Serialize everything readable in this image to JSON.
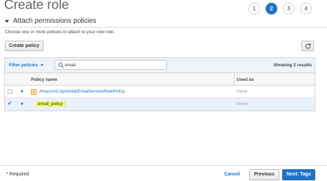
{
  "page": {
    "title": "Create role"
  },
  "steps": [
    {
      "label": "1"
    },
    {
      "label": "2"
    },
    {
      "label": "3"
    },
    {
      "label": "4"
    }
  ],
  "active_step": "2",
  "section": {
    "title": "Attach permissions policies",
    "subtitle": "Choose one or more policies to attach to your new role."
  },
  "toolbar": {
    "create_policy_label": "Create policy",
    "refresh_icon": "refresh-icon"
  },
  "filter": {
    "label": "Filter policies",
    "search_value": "email",
    "search_placeholder": "Search",
    "showing": "Showing 2 results"
  },
  "table": {
    "columns": {
      "policy_name": "Policy name",
      "used_as": "Used as"
    },
    "rows": [
      {
        "name": "AmazonCognitoIdpEmailServiceRolePolicy",
        "used_as": "None",
        "checked": false,
        "icon": "aws-managed-policy-icon"
      },
      {
        "name": "email_policy",
        "used_as": "None",
        "checked": true
      }
    ]
  },
  "footer": {
    "required": "* Required",
    "cancel": "Cancel",
    "previous": "Previous",
    "next": "Next: Tags"
  },
  "colors": {
    "accent": "#1f74c9",
    "highlight": "#f2f74d",
    "selected_row": "#e9f2fb"
  }
}
